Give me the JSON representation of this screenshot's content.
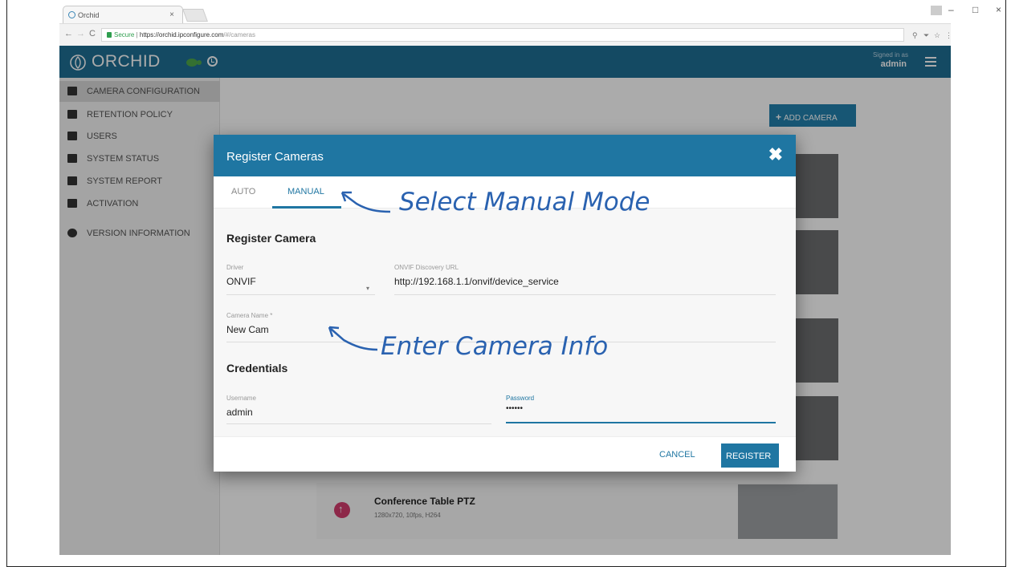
{
  "browser": {
    "tab_title": "Orchid",
    "tab_close": "×",
    "secure_label": "Secure",
    "url_host": "https://orchid.ipconfigure.com",
    "url_path": "/#/cameras",
    "window_min": "–",
    "window_max": "□",
    "window_close": "×",
    "nav_back": "←",
    "nav_forward": "→",
    "nav_reload": "C",
    "icons": [
      "search-icon",
      "filter-icon",
      "star-icon",
      "more-icon"
    ]
  },
  "app": {
    "logo_text": "ORCHID",
    "signed_in_label": "Signed in as",
    "signed_in_user": "admin",
    "brand_color": "#1f6f94"
  },
  "sidebar": {
    "items": [
      {
        "label": "CAMERA CONFIGURATION",
        "icon": "camera-icon",
        "active": true
      },
      {
        "label": "RETENTION POLICY",
        "icon": "database-icon"
      },
      {
        "label": "USERS",
        "icon": "user-icon"
      },
      {
        "label": "SYSTEM STATUS",
        "icon": "status-icon"
      },
      {
        "label": "SYSTEM REPORT",
        "icon": "report-icon"
      },
      {
        "label": "ACTIVATION",
        "icon": "plug-icon"
      },
      {
        "label": "VERSION INFORMATION",
        "icon": "info-icon"
      }
    ]
  },
  "main": {
    "add_camera_label": "ADD CAMERA",
    "camera_row": {
      "title": "Conference Table PTZ",
      "subtitle": "1280x720, 10fps, H264"
    }
  },
  "modal": {
    "title": "Register Cameras",
    "close": "✖",
    "tabs": [
      {
        "label": "AUTO",
        "active": false
      },
      {
        "label": "MANUAL",
        "active": true
      }
    ],
    "section_register": "Register Camera",
    "driver": {
      "label": "Driver",
      "value": "ONVIF",
      "caret": "▾"
    },
    "discovery_url": {
      "label": "ONVIF Discovery URL",
      "value": "http://192.168.1.1/onvif/device_service"
    },
    "camera_name": {
      "label": "Camera Name *",
      "value": "New Cam"
    },
    "section_credentials": "Credentials",
    "username": {
      "label": "Username",
      "value": "admin"
    },
    "password": {
      "label": "Password",
      "value": "••••••"
    },
    "cancel_label": "CANCEL",
    "register_label": "REGISTER"
  },
  "annotations": {
    "manual_mode": "Select Manual Mode",
    "camera_info": "Enter Camera Info",
    "color": "#2a62b0"
  }
}
